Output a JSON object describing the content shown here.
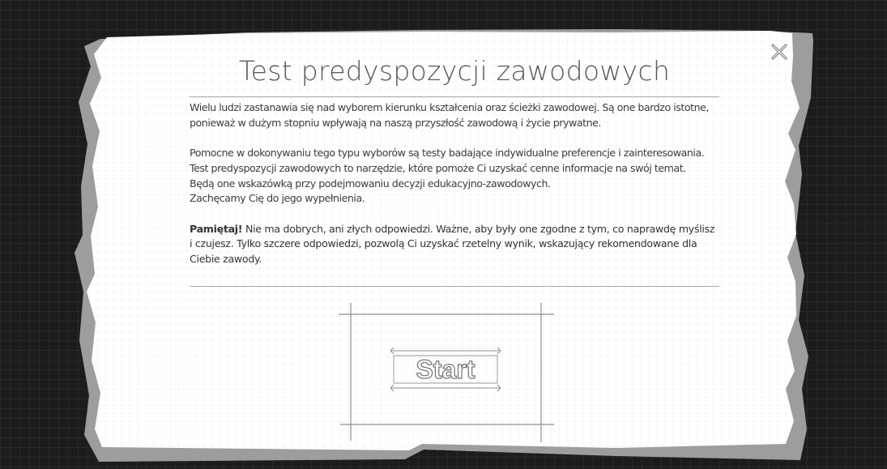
{
  "dialog": {
    "title": "Test predyspozycji zawodowych",
    "paragraph_1": "Wielu ludzi zastanawia się nad wyborem kierunku kształcenia oraz ścieżki zawodowej. Są one bardzo istotne,\nponieważ w dużym stopniu wpływają na naszą przyszłość zawodową i życie prywatne.",
    "paragraph_2": "Pomocne w dokonywaniu tego typu wyborów są testy badające indywidualne preferencje i zainteresowania.\nTest predyspozycji zawodowych to narzędzie, które pomoże Ci uzyskać cenne informacje na swój temat.\nBędą one wskazówką przy podejmowaniu decyzji edukacyjno-zawodowych.\nZachęcamy Cię do jego wypełnienia.",
    "note_lead": "Pamiętaj!",
    "note_body": " Nie ma dobrych, ani złych odpowiedzi. Ważne, aby były one zgodne z tym, co naprawdę myślisz\ni czujesz. Tylko szczere odpowiedzi, pozwolą Ci uzyskać rzetelny wynik, wskazujący rekomendowane dla\nCiebie zawody.",
    "start_label": "Start",
    "close_icon": "close-x-icon"
  },
  "colors": {
    "background": "#1c1c1c",
    "paper": "#ffffff",
    "paper_shadow": "#9c9c9c",
    "text": "#3c3c3c",
    "line": "#a9a9a9"
  }
}
